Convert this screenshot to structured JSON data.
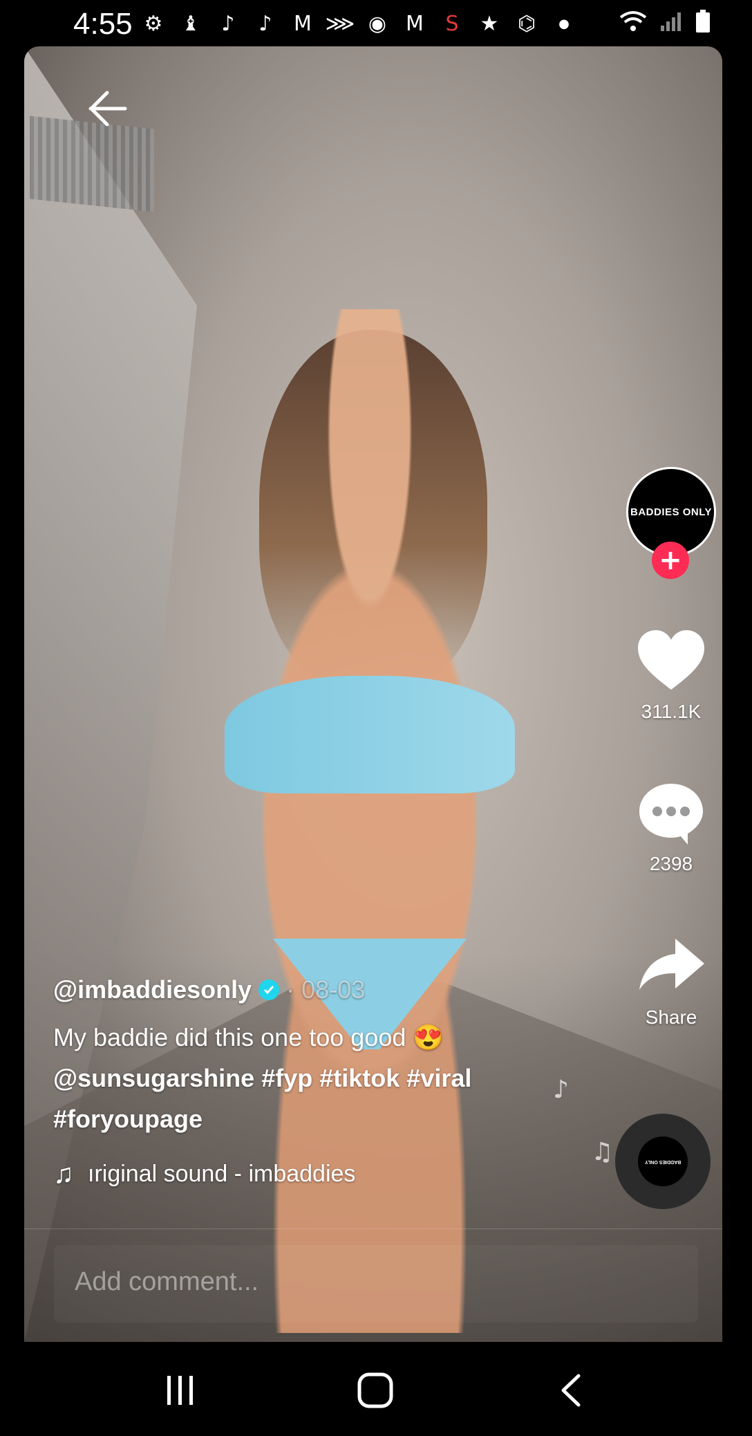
{
  "status_bar": {
    "time": "4:55",
    "notification_icons": [
      "gear-icon",
      "bishop-icon",
      "tiktok-icon",
      "tiktok-icon",
      "gmail-icon",
      "sprint-icon",
      "clock-icon",
      "gmail-icon",
      "stanford-icon",
      "star-icon",
      "incognito-icon",
      "dot-icon"
    ],
    "system_icons": [
      "wifi-icon",
      "signal-icon",
      "battery-icon"
    ]
  },
  "video": {
    "creator_handle": "@imbaddiesonly",
    "verified": true,
    "date_separator": "·",
    "date": "08-03",
    "caption_text": "My baddie did this one too good",
    "caption_emoji": "😍",
    "hashtags_line1": [
      "@sunsugarshine",
      "#fyp",
      "#tiktok",
      "#viral"
    ],
    "hashtags_line2": [
      "#foryoupage"
    ],
    "sound": "original sound - imbaddies",
    "sound_visible": "ıriginal sound - imbaddies"
  },
  "rail": {
    "avatar_text": "BADDIES ONLY",
    "follow_symbol": "+",
    "likes": "311.1K",
    "comments": "2398",
    "share_label": "Share",
    "disc_label": "BADDIES ONLY"
  },
  "comment_bar": {
    "placeholder": "Add comment..."
  },
  "colors": {
    "follow_accent": "#fe2c55",
    "verified_badge": "#20d5ec"
  }
}
